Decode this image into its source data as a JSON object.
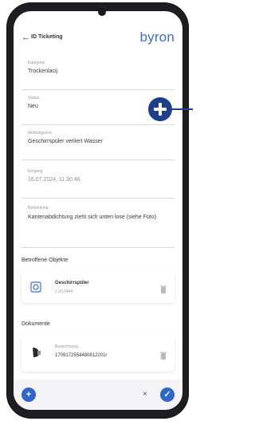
{
  "header": {
    "back_label": "←",
    "title": "ID Ticketing",
    "brand": "byron"
  },
  "form": {
    "fields": [
      {
        "label": "Kategorie",
        "value": "Trockenlacij"
      },
      {
        "label": "Status",
        "value": "Neu"
      },
      {
        "label": "Meldungstext",
        "value": "Geschirrspüler verliert Wasser"
      },
      {
        "label": "Eingang",
        "value": "16.07.2024, 11:30:46"
      },
      {
        "label": "Bemerkung",
        "value": "Kantenabdichtung zieht sich unten lose (siehe Foto)"
      }
    ]
  },
  "objects_section": {
    "title": "Betroffene Objekte",
    "item": {
      "name": "Geschirrspüler",
      "sub": "2.2/12444"
    }
  },
  "documents_section": {
    "title": "Dokumente",
    "item": {
      "label": "Bezeichnung",
      "name": "1709172554480812201r"
    }
  },
  "footer": {
    "close_glyph": "×",
    "add_glyph": "+",
    "confirm_glyph": "✓"
  },
  "colors": {
    "brand": "#3b6ed1",
    "accent": "#2f66c9",
    "callout": "#1d3f8c"
  }
}
